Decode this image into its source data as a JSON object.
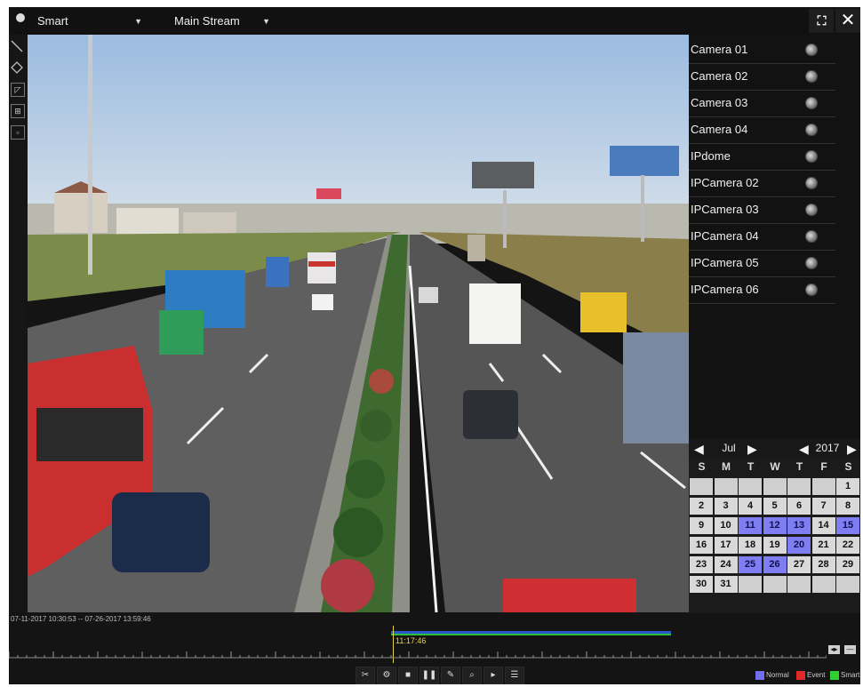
{
  "header": {
    "mode_dropdown": "Smart",
    "stream_dropdown": "Main Stream",
    "fullscreen_icon": "fullscreen-icon",
    "close_icon": "close-icon"
  },
  "cameras": [
    {
      "name": "Camera 01"
    },
    {
      "name": "Camera 02"
    },
    {
      "name": "Camera 03"
    },
    {
      "name": "Camera 04"
    },
    {
      "name": "IPdome"
    },
    {
      "name": "IPCamera 02"
    },
    {
      "name": "IPCamera 03"
    },
    {
      "name": "IPCamera 04"
    },
    {
      "name": "IPCamera 05"
    },
    {
      "name": "IPCamera 06"
    }
  ],
  "calendar": {
    "month": "Jul",
    "year": "2017",
    "weekdays": [
      "S",
      "M",
      "T",
      "W",
      "T",
      "F",
      "S"
    ],
    "leading_blanks": 6,
    "days_in_month": 31,
    "recorded_days": [
      11,
      12,
      13,
      15,
      20,
      25,
      26
    ]
  },
  "timeline": {
    "range_text": "07-11-2017 10:30:53 -- 07-26-2017 13:59:46",
    "cursor_time": "11:17:46"
  },
  "legend": [
    {
      "label": "Normal",
      "color": "#6f6ff0"
    },
    {
      "label": "Event",
      "color": "#e02a2a"
    },
    {
      "label": "Smart",
      "color": "#2ed12e"
    }
  ],
  "colors": {
    "accent_record": "#7e7ef2",
    "panel_bg": "#141414"
  }
}
